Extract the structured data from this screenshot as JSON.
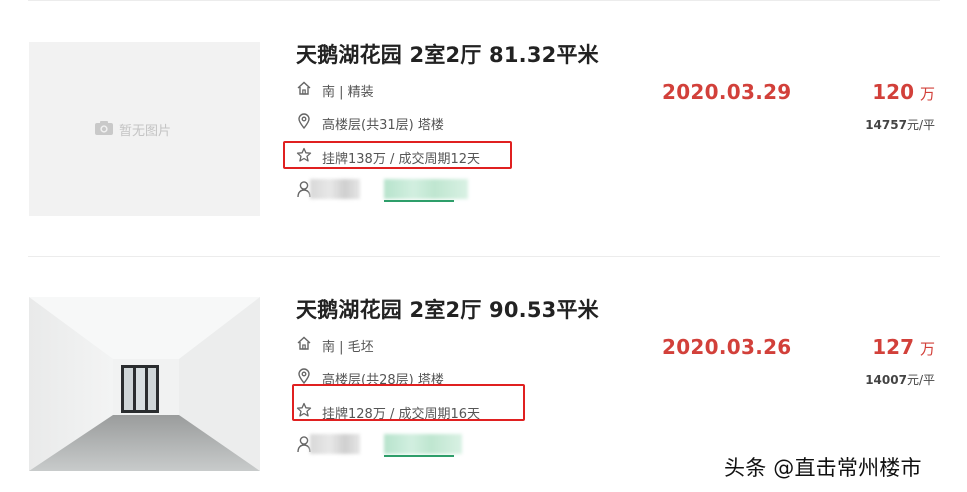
{
  "listings": [
    {
      "title": "天鹅湖花园 2室2厅 81.32平米",
      "orientation_decor": "南 | 精装",
      "floor": "高楼层(共31层) 塔楼",
      "deal_info": "挂牌138万 / 成交周期12天",
      "date": "2020.03.29",
      "price": "120",
      "price_unit": "万",
      "unit_price": "14757",
      "unit_price_suffix": "元/平",
      "no_image_text": "暂无图片",
      "has_image": false
    },
    {
      "title": "天鹅湖花园 2室2厅 90.53平米",
      "orientation_decor": "南 | 毛坯",
      "floor": "高楼层(共28层) 塔楼",
      "deal_info": "挂牌128万 / 成交周期16天",
      "date": "2020.03.26",
      "price": "127",
      "price_unit": "万",
      "unit_price": "14007",
      "unit_price_suffix": "元/平",
      "has_image": true
    }
  ],
  "watermark": "头条 @直击常州楼市",
  "colors": {
    "accent_red": "#d2403a",
    "highlight_box": "#e02020",
    "agent_green": "#2e9e6a"
  },
  "icons": [
    "camera-icon",
    "house-icon",
    "location-pin-icon",
    "star-icon",
    "person-icon"
  ]
}
